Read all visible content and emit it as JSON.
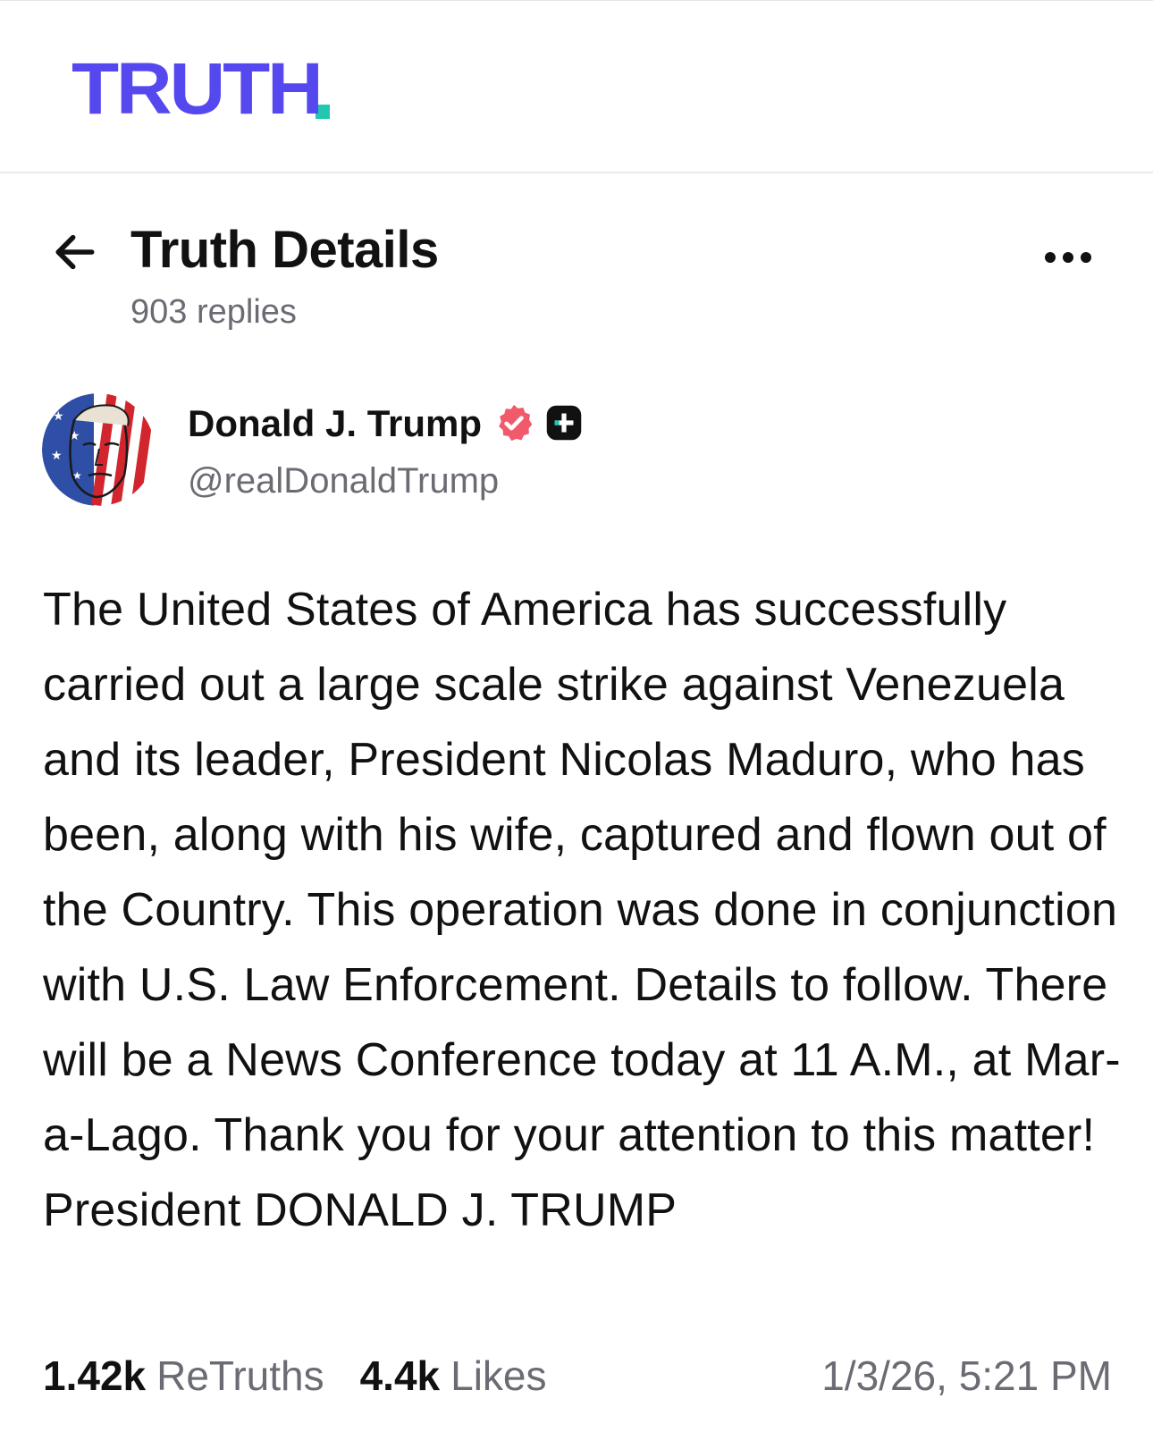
{
  "brand": {
    "logo_text": "TRUTH",
    "accent_color": "#5448ee",
    "dot_color": "#21c7ae"
  },
  "header": {
    "back_icon": "arrow-left-icon",
    "title": "Truth Details",
    "replies": "903 replies",
    "more_icon": "more-horizontal-icon"
  },
  "author": {
    "display_name": "Donald J. Trump",
    "handle": "@realDonaldTrump",
    "verified_badge_color": "#f05a6a",
    "avatar_icon": "avatar-flag-portrait"
  },
  "post": {
    "text": "The United States of America has successfully carried out a large scale strike against Venezuela and its leader, President Nicolas Maduro, who has been, along with his wife, captured and flown out of the Country. This operation was done in conjunction with U.S. Law Enforcement. Details to follow. There will be a News Conference today at 11 A.M., at Mar-a-Lago. Thank you for your attention to this matter! President DONALD J. TRUMP"
  },
  "stats": {
    "retruths_count": "1.42k",
    "retruths_label": "ReTruths",
    "likes_count": "4.4k",
    "likes_label": "Likes",
    "timestamp": "1/3/26, 5:21 PM"
  }
}
